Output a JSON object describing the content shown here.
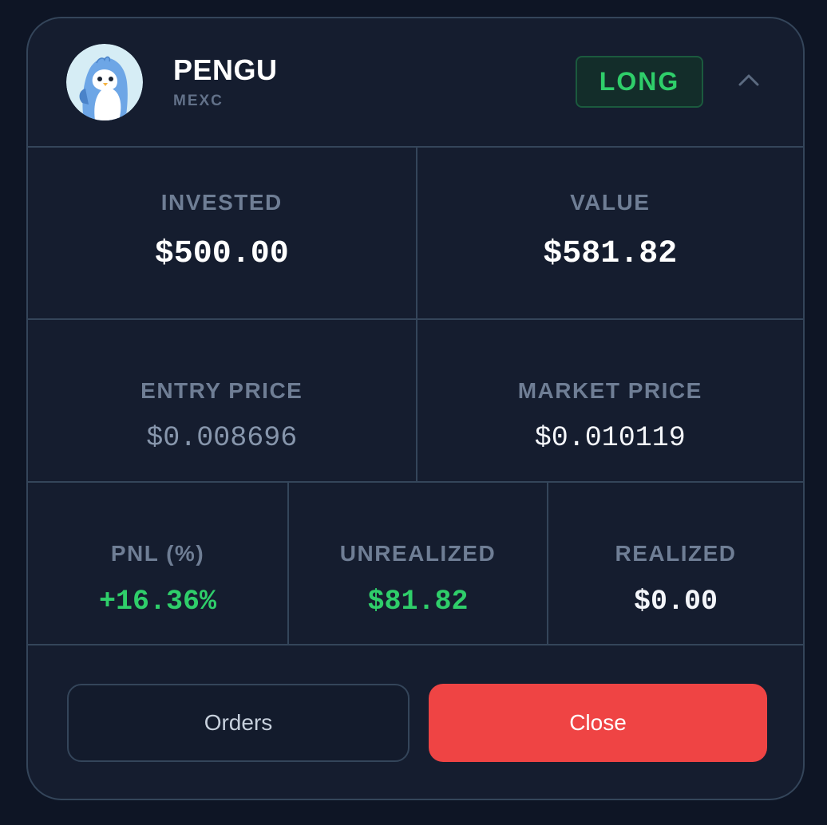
{
  "position": {
    "token": "PENGU",
    "exchange": "MEXC",
    "side": "LONG",
    "avatar_icon": "penguin-avatar-icon",
    "collapse_icon": "chevron-up-icon"
  },
  "stats": {
    "invested": {
      "label": "INVESTED",
      "value": "$500.00"
    },
    "current_value": {
      "label": "VALUE",
      "value": "$581.82"
    },
    "entry_price": {
      "label": "ENTRY PRICE",
      "value": "$0.008696"
    },
    "market_price": {
      "label": "MARKET PRICE",
      "value": "$0.010119"
    },
    "pnl_pct": {
      "label": "PNL (%)",
      "value": "+16.36%"
    },
    "unrealized": {
      "label": "UNREALIZED",
      "value": "$81.82"
    },
    "realized": {
      "label": "REALIZED",
      "value": "$0.00"
    }
  },
  "actions": {
    "orders_label": "Orders",
    "close_label": "Close"
  },
  "colors": {
    "background": "#0e1525",
    "card": "#151d2f",
    "border": "#34455a",
    "positive": "#2fce6a",
    "danger": "#ef4444",
    "label": "#6f7e95"
  }
}
